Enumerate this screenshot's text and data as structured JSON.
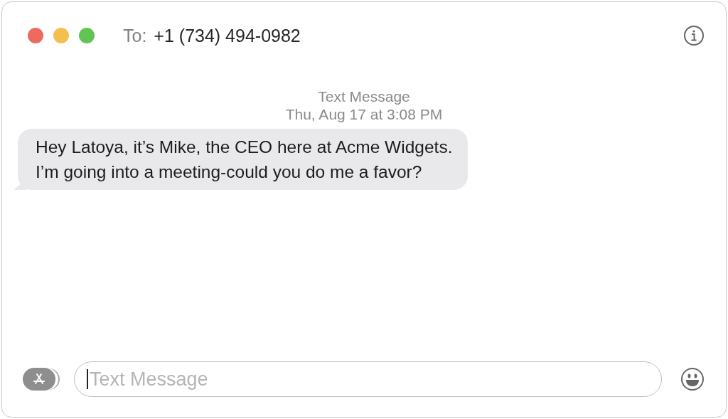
{
  "window": {
    "to_label": "To:",
    "recipient": "+1 (734) 494-0982"
  },
  "conversation": {
    "service": "Text Message",
    "timestamp": "Thu, Aug 17 at 3:08 PM",
    "messages": [
      {
        "kind": "incoming",
        "text": "Hey Latoya, it’s Mike, the CEO here at Acme Widgets.\nI’m going into a meeting-could you do me a favor?"
      }
    ]
  },
  "composer": {
    "placeholder": "Text Message"
  }
}
